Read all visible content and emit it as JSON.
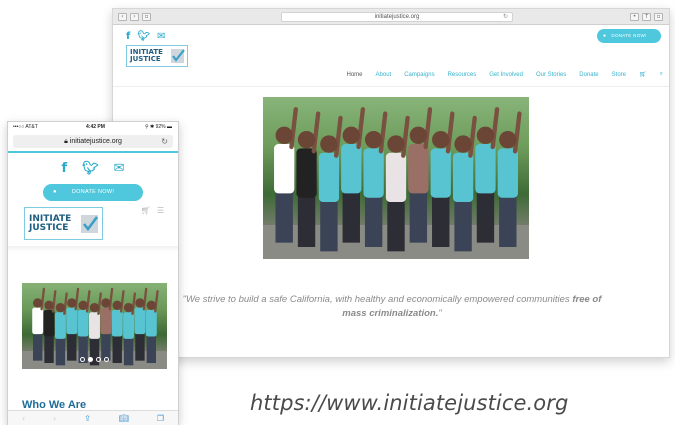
{
  "desktop": {
    "url": "initiatejustice.org",
    "social": [
      "f",
      "t",
      "m"
    ],
    "donate_label": "DONATE NOW!",
    "logo": {
      "line1": "INITIATE",
      "line2": "JUSTICE"
    },
    "nav": [
      "Home",
      "About",
      "Campaigns",
      "Resources",
      "Get Involved",
      "Our Stories",
      "Donate",
      "Store"
    ],
    "quote_prefix": "\"We strive to build a safe California, with healthy and economically empowered communities ",
    "quote_bold": "free of mass criminalization.",
    "quote_suffix": "\""
  },
  "phone": {
    "carrier": "•••○○ AT&T",
    "time": "4:42 PM",
    "battery": "92%",
    "url": "initiatejustice.org",
    "donate_label": "DONATE NOW!",
    "logo": {
      "line1": "INITIATE",
      "line2": "JUSTICE"
    },
    "heading": "Who We Are",
    "carousel_active_dot": 1
  },
  "caption": "https://www.initiatejustice.org",
  "colors": {
    "accent": "#4fc8de",
    "brand_blue": "#1d5d80"
  }
}
